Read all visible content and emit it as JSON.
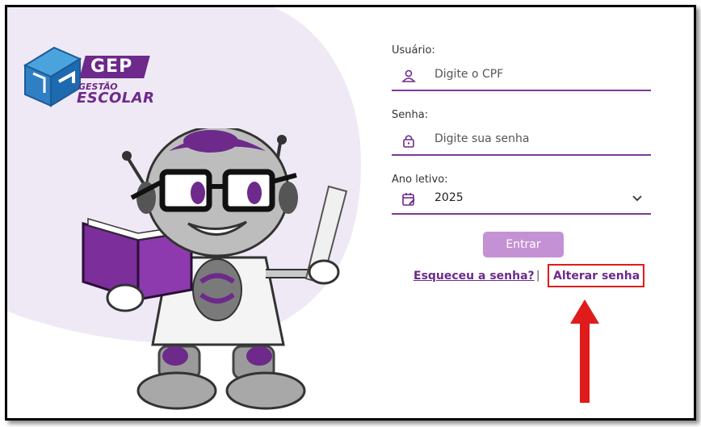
{
  "logo": {
    "badge": "GEP",
    "line1": "GESTÃO",
    "line2": "ESCOLAR"
  },
  "form": {
    "usuario": {
      "label": "Usuário:",
      "placeholder": "Digite o CPF",
      "icon": "user-icon"
    },
    "senha": {
      "label": "Senha:",
      "placeholder": "Digite sua senha",
      "icon": "lock-icon"
    },
    "ano": {
      "label": "Ano letivo:",
      "value": "2025",
      "icon": "calendar-edit-icon"
    },
    "submit_label": "Entrar",
    "forgot_label": "Esqueceu a senha?",
    "separator": "|",
    "alter_label": "Alterar senha"
  },
  "colors": {
    "brand": "#6d2a8a",
    "button": "#c492d4",
    "highlight": "#e01b1b",
    "background_blob": "#efe9f5"
  }
}
